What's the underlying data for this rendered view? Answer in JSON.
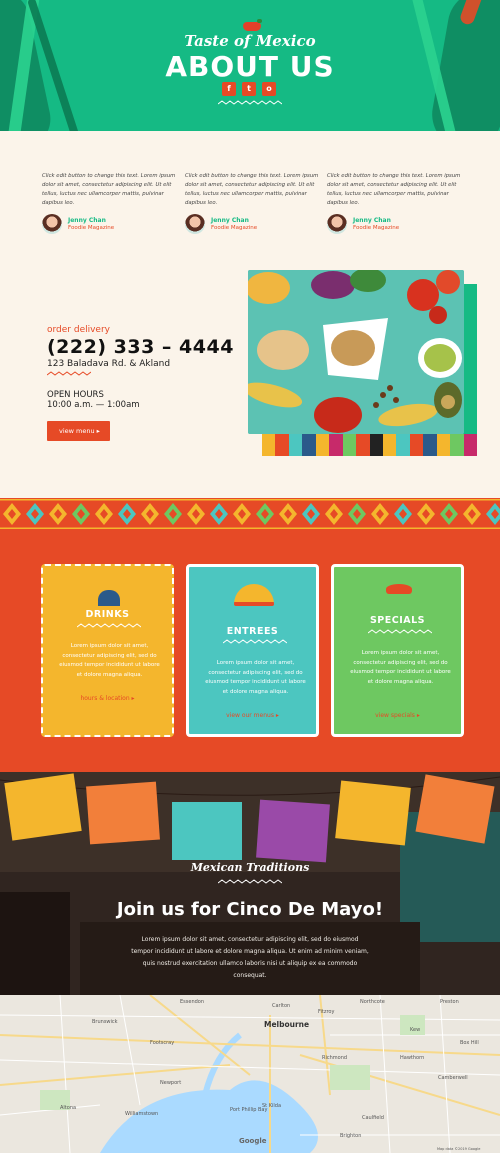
{
  "hero": {
    "subtitle": "Taste of Mexico",
    "title": "ABOUT US",
    "socials": [
      {
        "icon": "facebook-icon",
        "glyph": "f"
      },
      {
        "icon": "twitter-icon",
        "glyph": "t"
      },
      {
        "icon": "instagram-icon",
        "glyph": "o"
      }
    ]
  },
  "testimonials": [
    {
      "text": "Click edit button to change this text. Lorem ipsum dolor sit amet, consectetur adipiscing elit. Ut elit tellus, luctus nec ullamcorper mattis, pulvinar dapibus leo.",
      "name": "Jenny Chan",
      "org": "Foodie Magazine"
    },
    {
      "text": "Click edit button to change this text. Lorem ipsum dolor sit amet, consectetur adipiscing elit. Ut elit tellus, luctus nec ullamcorper mattis, pulvinar dapibus leo.",
      "name": "Jenny Chan",
      "org": "Foodie Magazine"
    },
    {
      "text": "Click edit button to change this text. Lorem ipsum dolor sit amet, consectetur adipiscing elit. Ut elit tellus, luctus nec ullamcorper mattis, pulvinar dapibus leo.",
      "name": "Jenny Chan",
      "org": "Foodie Magazine"
    }
  ],
  "contact": {
    "order_label": "order delivery",
    "phone": "(222) 333 – 4444",
    "address": "123 Baladava Rd. & Akland",
    "hours_label": "OPEN HOURS",
    "hours_value": "10:00 a.m. — 1:00am",
    "menu_button": "view menu"
  },
  "cards": [
    {
      "title": "DRINKS",
      "text": "Lorem ipsum dolor sit amet, consectetur adipiscing elit, sed do eiusmod tempor incididunt ut labore et dolore magna aliqua.",
      "link": "hours & location",
      "color": "#f4b62d"
    },
    {
      "title": "ENTREES",
      "text": "Lorem ipsum dolor sit amet, consectetur adipiscing elit, sed do eiusmod tempor incididunt ut labore et dolore magna aliqua.",
      "link": "view our menus",
      "color": "#4cc6c0"
    },
    {
      "title": "SPECIALS",
      "text": "Lorem ipsum dolor sit amet, consectetur adipiscing elit, sed do eiusmod tempor incididunt ut labore et dolore magna aliqua.",
      "link": "view specials",
      "color": "#6ec861"
    }
  ],
  "event": {
    "kicker": "Mexican Traditions",
    "title": "Join us for Cinco De Mayo!",
    "text": "Lorem ipsum dolor sit amet, consectetur adipiscing elit, sed do eiusmod tempor incididunt ut labore et dolore magna aliqua. Ut enim ad minim veniam, quis nostrud exercitation ullamco laboris nisi ut aliquip ex ea commodo consequat."
  },
  "map": {
    "main_city": "Melbourne",
    "labels": [
      "Melbourne",
      "Brunswick",
      "Carlton",
      "Fitzroy",
      "Richmond",
      "St Kilda",
      "Footscray",
      "Kew",
      "Camberwell",
      "Hawthorn",
      "Williamstown",
      "Altona",
      "Brighton",
      "Port Phillip Bay",
      "Essendon",
      "Northcote",
      "Preston",
      "Box Hill",
      "Caulfield",
      "Newport"
    ],
    "google": "Google",
    "attribution": "Map data ©2019 Google"
  },
  "colors": {
    "green": "#15ba84",
    "orange": "#e64a26",
    "yellow": "#f4b62d",
    "teal": "#4cc6c0",
    "lime": "#6ec861"
  }
}
